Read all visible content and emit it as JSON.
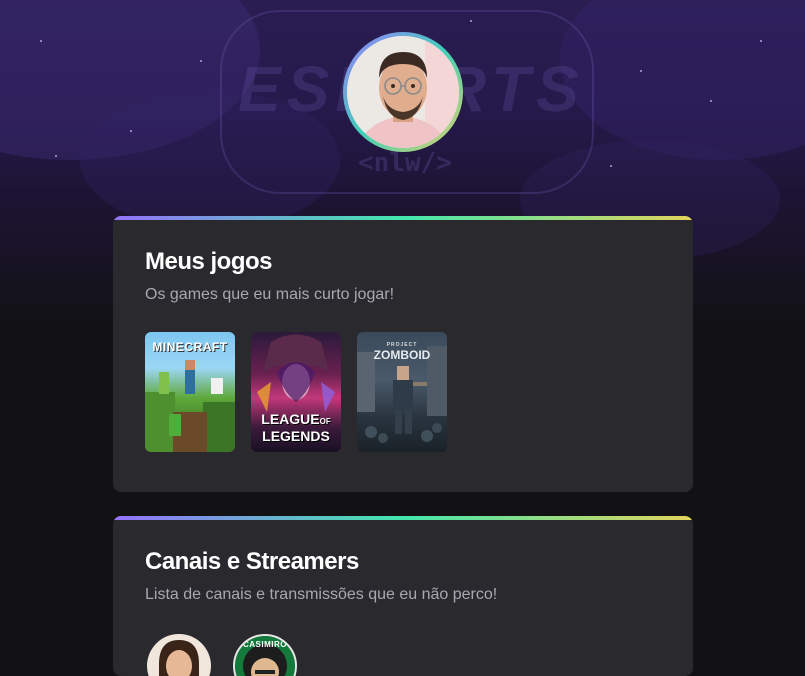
{
  "profile": {
    "background_logo_text": "ESPORTS",
    "background_logo_sub": "<nlw/>",
    "avatar_alt": "profile-photo"
  },
  "games_card": {
    "title": "Meus jogos",
    "subtitle": "Os games que eu mais curto jogar!",
    "games": [
      {
        "title": "MINECRAFT"
      },
      {
        "title_line1": "LEAGUE",
        "title_of": "OF",
        "title_line2": "LEGENDS"
      },
      {
        "title_small": "PROJECT",
        "title": "ZOMBOID"
      }
    ]
  },
  "streamers_card": {
    "title": "Canais e Streamers",
    "subtitle": "Lista de canais e transmissões que eu não perco!",
    "streamers": [
      {
        "badge": ""
      },
      {
        "badge": "CASIMIRO"
      }
    ]
  },
  "colors": {
    "background": "#121214",
    "card": "#29292e",
    "gradient_start": "#9572fc",
    "gradient_mid": "#43e7ad",
    "gradient_end": "#e2d45c",
    "title": "#ffffff",
    "subtitle": "#a8a8b3"
  }
}
